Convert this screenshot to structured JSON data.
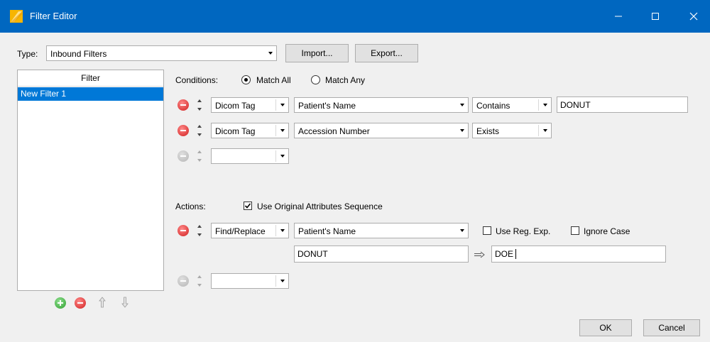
{
  "window": {
    "title": "Filter Editor"
  },
  "type_row": {
    "label": "Type:",
    "selected": "Inbound Filters",
    "import_label": "Import...",
    "export_label": "Export..."
  },
  "filter_list": {
    "header": "Filter",
    "items": [
      "New Filter 1"
    ],
    "selected_index": 0
  },
  "conditions": {
    "label": "Conditions:",
    "match_all": "Match All",
    "match_any": "Match Any",
    "match_selected": "Match All",
    "rows": [
      {
        "source": "Dicom Tag",
        "attribute": "Patient's Name",
        "operator": "Contains",
        "value": "DONUT"
      },
      {
        "source": "Dicom Tag",
        "attribute": "Accession Number",
        "operator": "Exists"
      },
      {
        "source": ""
      }
    ]
  },
  "actions": {
    "label": "Actions:",
    "use_original_label": "Use Original Attributes Sequence",
    "use_original_checked": true,
    "rows": [
      {
        "action": "Find/Replace",
        "attribute": "Patient's Name",
        "use_regexp_label": "Use Reg. Exp.",
        "use_regexp_checked": false,
        "ignore_case_label": "Ignore Case",
        "ignore_case_checked": false,
        "find": "DONUT",
        "replace": "DOE"
      },
      {
        "action": ""
      }
    ]
  },
  "footer": {
    "ok_label": "OK",
    "cancel_label": "Cancel"
  },
  "colors": {
    "titlebar": "#0067c0",
    "selection": "#0078d7",
    "remove": "#d01e1e",
    "add": "#2f9e2f"
  }
}
